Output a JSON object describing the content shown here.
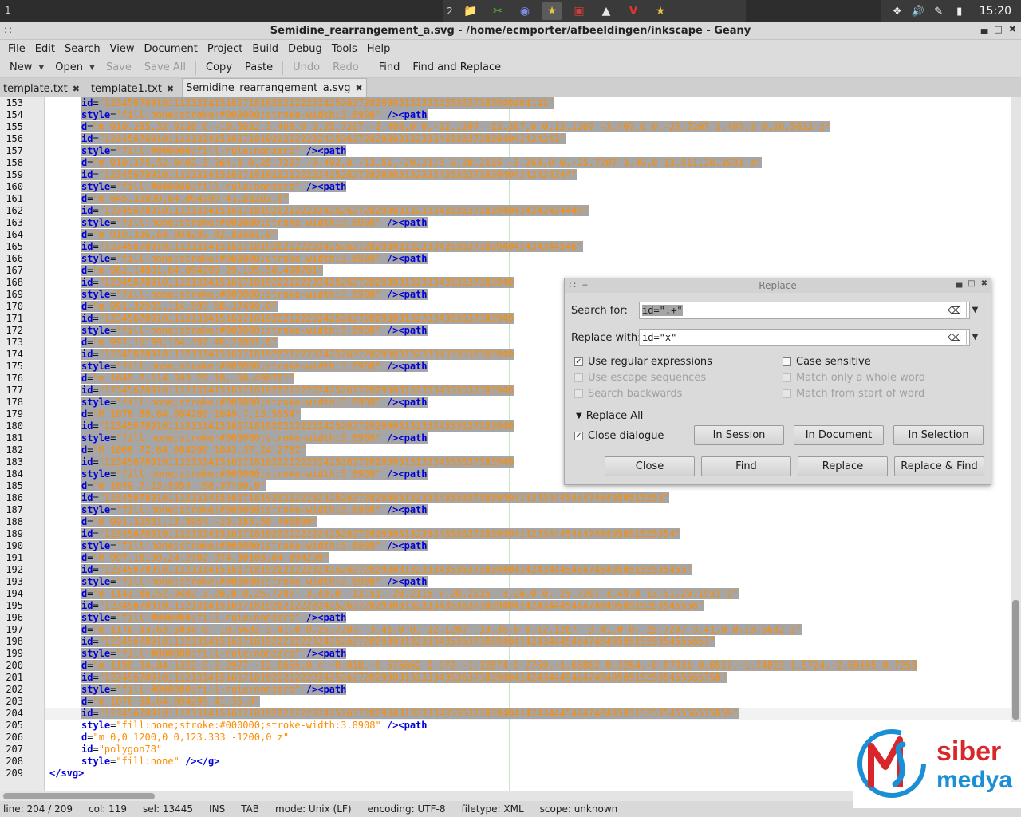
{
  "taskbar": {
    "workspace_left": "1",
    "workspace_num": "2",
    "clock": "15:20"
  },
  "window": {
    "title": "Semidine_rearrangement_a.svg - /home/ecmporter/afbeeldingen/inkscape - Geany"
  },
  "menu": [
    "File",
    "Edit",
    "Search",
    "View",
    "Document",
    "Project",
    "Build",
    "Debug",
    "Tools",
    "Help"
  ],
  "toolbar": {
    "new": "New",
    "open": "Open",
    "save": "Save",
    "save_all": "Save All",
    "copy": "Copy",
    "paste": "Paste",
    "undo": "Undo",
    "redo": "Redo",
    "find": "Find",
    "find_replace": "Find and Replace"
  },
  "tabs": [
    {
      "label": "template.txt"
    },
    {
      "label": "template1.txt"
    },
    {
      "label": "Semidine_rearrangement_a.svg",
      "active": true
    }
  ],
  "lines": [
    {
      "n": "153",
      "attr": "id",
      "val": "\"12345678910111213141516171819202122232425262728293031323334353637383940404142\"",
      "end": "",
      "sel": true
    },
    {
      "n": "154",
      "attr": "style",
      "val": "\"fill:none;stroke:#000000;stroke-width:3.8908\"",
      "end": " /><path",
      "sel": true
    },
    {
      "n": "155",
      "attr": "d",
      "val": "\"m 910.285,32.9138 0,-10.5632 3.408,0 0,25.7207 -3.408,0 0,-12.1207 -13.367,0 0,12.1207 -3.407,0 0,-25.7207 3.407,0 0,10.5632 z\"",
      "end": "",
      "sel": true
    },
    {
      "n": "156",
      "attr": "id",
      "val": "\"1234567891011121314151617181920212223242526272829303132333435363738394041424243\"",
      "end": "",
      "sel": true
    },
    {
      "n": "157",
      "attr": "style",
      "val": "\"fill:#000000;fill-rule:nonzero\"",
      "end": " /><path",
      "sel": true
    },
    {
      "n": "158",
      "attr": "d",
      "val": "\"m 910.375,52.9402 3.264,0 0,25.7207 -3.492,0 -13.51,-20.2115 0,20.2115 -3.263,0 0,-25.7207 3.49,0 13.511,20.1931 z\"",
      "end": "",
      "sel": true
    },
    {
      "n": "159",
      "attr": "id",
      "val": "\"123456789101112131415161718192021222324252627282930313233343536373839404142424344\"",
      "end": "",
      "sel": true
    },
    {
      "n": "160",
      "attr": "style",
      "val": "\"fill:#000000;fill-rule:nonzero\"",
      "end": " /><path",
      "sel": true
    },
    {
      "n": "161",
      "attr": "d",
      "val": "\"m 845.39899,64.094299 41.83203,0\"",
      "end": "",
      "sel": true
    },
    {
      "n": "162",
      "attr": "id",
      "val": "\"12345678910111213141516171819202122232425262728293031323334353637383940414242434445\"",
      "end": "",
      "sel": true
    },
    {
      "n": "163",
      "attr": "style",
      "val": "\"fill:none;stroke:#000000;stroke-width:3.8908\"",
      "end": " /><path",
      "sel": true
    },
    {
      "n": "164",
      "attr": "d",
      "val": "\"m 919.336,64.094299 42.80401,0\"",
      "end": "",
      "sel": true
    },
    {
      "n": "165",
      "attr": "id",
      "val": "\"1234567891011121314151617181920212223242526272829303132333435363738394041424344546\"",
      "end": "",
      "sel": true
    },
    {
      "n": "166",
      "attr": "style",
      "val": "\"fill:none;stroke:#000000;stroke-width:3.8908\"",
      "end": " /><path",
      "sel": true
    },
    {
      "n": "167",
      "attr": "d",
      "val": "\"m 962.14001,64.094299 29.185,50.498701\"",
      "end": "",
      "sel": true
    },
    {
      "n": "168",
      "attr": "id",
      "val": "\"12345678910111213141516171819202122232425262728293031323334353637383940",
      "end": "",
      "sel": true
    },
    {
      "n": "169",
      "attr": "style",
      "val": "\"fill:none;stroke:#000000;stroke-width:3.8908\"",
      "end": " /><path",
      "sel": true
    },
    {
      "n": "170",
      "attr": "d",
      "val": "\"m 991.32501,114.593 58.37499,0\"",
      "end": "",
      "sel": true
    },
    {
      "n": "171",
      "attr": "id",
      "val": "\"12345678910111213141516171819202122232425262728293031323334353637383940",
      "end": "",
      "sel": true
    },
    {
      "n": "172",
      "attr": "style",
      "val": "\"fill:none;stroke:#000000;stroke-width:3.8908\"",
      "end": " /><path",
      "sel": true
    },
    {
      "n": "173",
      "attr": "d",
      "val": "\"m 997.16199,104.397 46.20801,0\"",
      "end": "",
      "sel": true
    },
    {
      "n": "174",
      "attr": "id",
      "val": "\"12345678910111213141516171819202122232425262728293031323334353637383940",
      "end": "",
      "sel": true
    },
    {
      "n": "175",
      "attr": "style",
      "val": "\"fill:none;stroke:#000000;stroke-width:3.8908\"",
      "end": " /><path",
      "sel": true
    },
    {
      "n": "176",
      "attr": "d",
      "val": "\"m 1049.7,114.593 29.18,-50.498701\"",
      "end": "",
      "sel": true
    },
    {
      "n": "177",
      "attr": "id",
      "val": "\"12345678910111213141516171819202122232425262728293031323334353637383940",
      "end": "",
      "sel": true
    },
    {
      "n": "178",
      "attr": "style",
      "val": "\"fill:none;stroke:#000000;stroke-width:3.8908\"",
      "end": " /><path",
      "sel": true
    },
    {
      "n": "179",
      "attr": "d",
      "val": "\"M 1078.88,64.094299 1049.7,13.5954\"",
      "end": "",
      "sel": true
    },
    {
      "n": "180",
      "attr": "id",
      "val": "\"12345678910111213141516171819202122232425262728293031323334353637383940",
      "end": "",
      "sel": true
    },
    {
      "n": "181",
      "attr": "style",
      "val": "\"fill:none;stroke:#000000;stroke-width:3.8908\"",
      "end": " /><path",
      "sel": true
    },
    {
      "n": "182",
      "attr": "d",
      "val": "\"M 1066.72,64.094299 1043.37,24.2782\"",
      "end": "",
      "sel": true
    },
    {
      "n": "183",
      "attr": "id",
      "val": "\"12345678910111213141516171819202122232425262728293031323334353637383940",
      "end": "",
      "sel": true
    },
    {
      "n": "184",
      "attr": "style",
      "val": "\"fill:none;stroke:#000000;stroke-width:3.8908\"",
      "end": " /><path",
      "sel": true
    },
    {
      "n": "185",
      "attr": "d",
      "val": "\"m 1049.7,13.5954 -58.37499,0\"",
      "end": "",
      "sel": true
    },
    {
      "n": "186",
      "attr": "id",
      "val": "\"1234567891011121314151617181920212223242526272829303132333435363738394041424344454647484950515253\"",
      "end": "",
      "sel": true
    },
    {
      "n": "187",
      "attr": "style",
      "val": "\"fill:none;stroke:#000000;stroke-width:3.8908\"",
      "end": " /><path",
      "sel": true
    },
    {
      "n": "188",
      "attr": "d",
      "val": "\"m 991.32501,13.5954 -29.185,50.498899\"",
      "end": "",
      "sel": true
    },
    {
      "n": "189",
      "attr": "id",
      "val": "\"123456789101112131415161718192021222324252627282930313233343536373839404142434445464748495051525354\"",
      "end": "",
      "sel": true
    },
    {
      "n": "190",
      "attr": "style",
      "val": "\"fill:none;stroke:#000000;stroke-width:3.8908\"",
      "end": " /><path",
      "sel": true
    },
    {
      "n": "191",
      "attr": "d",
      "val": "\"M 997.16199,24.2782 974.30103,64.094299\"",
      "end": "",
      "sel": true
    },
    {
      "n": "192",
      "attr": "id",
      "val": "\"12345678910111213141516171819202122232425262728293031323334353637383940414243444546474849505152535455\"",
      "end": "",
      "sel": true
    },
    {
      "n": "193",
      "attr": "style",
      "val": "\"fill:none;stroke:#000000;stroke-width:3.8908\"",
      "end": " /><path",
      "sel": true
    },
    {
      "n": "194",
      "attr": "d",
      "val": "\"m 1143.86,52.9402 3.26,0 0,25.7207 -3.49,0 -13.51,-20.2115 0,20.2115 -3.26,0 0,-25.7207 3.49,0 13.51,20.1931 z\"",
      "end": "",
      "sel": true
    },
    {
      "n": "195",
      "attr": "id",
      "val": "\"1234567891011121314151617181920212223242526272829303132333435363738394041424344454647484950515253545556\"",
      "end": "",
      "sel": true
    },
    {
      "n": "196",
      "attr": "style",
      "val": "\"fill:#000000;fill-rule:nonzero\"",
      "end": " /><path",
      "sel": true
    },
    {
      "n": "197",
      "attr": "d",
      "val": "\"m 1170.03,63.5034 0,-10.5632 3.41,0 0,25.7207 -3.41,0 0,-12.1207 -13.36,0 0,12.1207 -3.41,0 0,-25.7207 3.41,0 0,10.5632 z\"",
      "end": "",
      "sel": true
    },
    {
      "n": "198",
      "attr": "id",
      "val": "\"123456789101112131415161718192021222324252627282930313233343536373839404142434445464748495051525354555657\"",
      "end": "",
      "sel": true
    },
    {
      "n": "199",
      "attr": "style",
      "val": "\"fill:#000000;fill-rule:nonzero\"",
      "end": " /><path",
      "sel": true
    },
    {
      "n": "200",
      "attr": "d",
      "val": "\"m 1190.34,84.1322 0,2.2977 -12.8655,0 c -0.018,-0.575862 0.072,-1.12874 0.2759,-1.65862 0.3264,-0.87931 0.8517,-1.74023 1.5724,-2.59195 0.7253",
      "end": "",
      "sel": true
    },
    {
      "n": "201",
      "attr": "id",
      "val": "\"12345678910111213141516171819202122232425262728293031323334353637383940414243444546474849505152535455565758\"",
      "end": "",
      "sel": true
    },
    {
      "n": "202",
      "attr": "style",
      "val": "\"fill:#000000;fill-rule:nonzero\"",
      "end": " /><path",
      "sel": true
    },
    {
      "n": "203",
      "attr": "d",
      "val": "\"m 1078.88,64.094299 41.35,0\"",
      "end": "",
      "sel": true
    },
    {
      "n": "204",
      "attr": "id",
      "val": "\"1234567891011121314151617181920212223242526272829303132333435363738394041424344454647484950515253545556575859\"",
      "end": "",
      "sel": true
    },
    {
      "n": "205",
      "attr": "style",
      "val": "\"fill:none;stroke:#000000;stroke-width:3.8908\"",
      "end": " /><path",
      "sel": false
    },
    {
      "n": "206",
      "attr": "d",
      "val": "\"m 0,0 1200,0 0,123.333 -1200,0 z\"",
      "end": "",
      "sel": false
    },
    {
      "n": "207",
      "attr": "id",
      "val": "\"polygon78\"",
      "end": "",
      "sel": false
    },
    {
      "n": "208",
      "attr": "style",
      "val": "\"fill:none\"",
      "end": " /></g>",
      "sel": false
    },
    {
      "n": "209",
      "attr": "",
      "val": "",
      "end": "</svg>",
      "sel": false,
      "raw": true
    }
  ],
  "status": {
    "line": "line: 204 / 209",
    "col": "col: 119",
    "sel": "sel: 13445",
    "ins": "INS",
    "tab": "TAB",
    "mode": "mode: Unix (LF)",
    "encoding": "encoding: UTF-8",
    "filetype": "filetype: XML",
    "scope": "scope: unknown"
  },
  "dialog": {
    "title": "Replace",
    "search_label": "Search for:",
    "search_value": "id=\".+\"",
    "replace_label": "Replace with:",
    "replace_value": "id=\"x\"",
    "use_regex": "Use regular expressions",
    "use_escape": "Use escape sequences",
    "search_backwards": "Search backwards",
    "case_sensitive": "Case sensitive",
    "whole_word": "Match only a whole word",
    "from_start": "Match from start of word",
    "replace_all": "Replace All",
    "close_dialogue": "Close dialogue",
    "in_session": "In Session",
    "in_document": "In Document",
    "in_selection": "In Selection",
    "close": "Close",
    "find": "Find",
    "replace": "Replace",
    "replace_find": "Replace & Find"
  },
  "logo": {
    "line1": "siber",
    "line2": "medya",
    "colors": {
      "red": "#d9262b",
      "blue": "#1a8fd6"
    }
  }
}
